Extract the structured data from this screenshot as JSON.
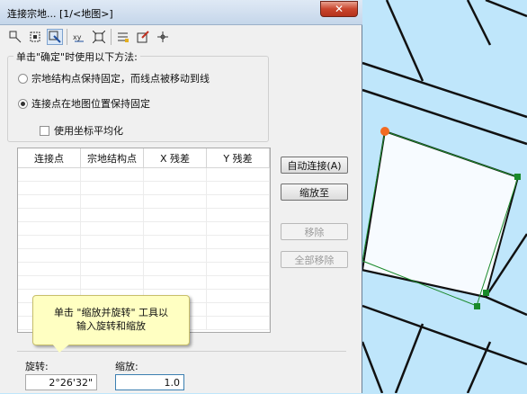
{
  "window": {
    "title": "连接宗地... [1/<地图>]",
    "close_label": "✕"
  },
  "toolbar": {
    "icons": [
      "connect-icon",
      "select-icon",
      "zoom-rotate-icon",
      "xy-icon",
      "fit-icon",
      "list-icon",
      "edit-icon",
      "pan-icon"
    ],
    "active_index": 2
  },
  "group": {
    "legend": "单击\"确定\"时使用以下方法:",
    "option1": "宗地结构点保持固定，而线点被移动到线",
    "option2": "连接点在地图位置保持固定",
    "selected": 2,
    "checkbox_label": "使用坐标平均化",
    "checkbox_checked": false
  },
  "table": {
    "headers": [
      "连接点",
      "宗地结构点",
      "X 残差",
      "Y 残差"
    ],
    "rows": []
  },
  "buttons": {
    "auto_connect": "自动连接(A)",
    "zoom_to": "缩放至",
    "move": "移除",
    "remove_all": "全部移除"
  },
  "tooltip": {
    "line1": "单击 \"缩放并旋转\" 工具以",
    "line2": "输入旋转和缩放"
  },
  "bottom": {
    "rotation_label": "旋转:",
    "rotation_value": "2°26'32\"",
    "scale_label": "缩放:",
    "scale_value": "1.0"
  },
  "colors": {
    "map_fill": "#bfe6fb",
    "parcel_fill": "#f7fbff",
    "connector_orange": "#f26a21",
    "connector_green": "#1a8a2a"
  }
}
